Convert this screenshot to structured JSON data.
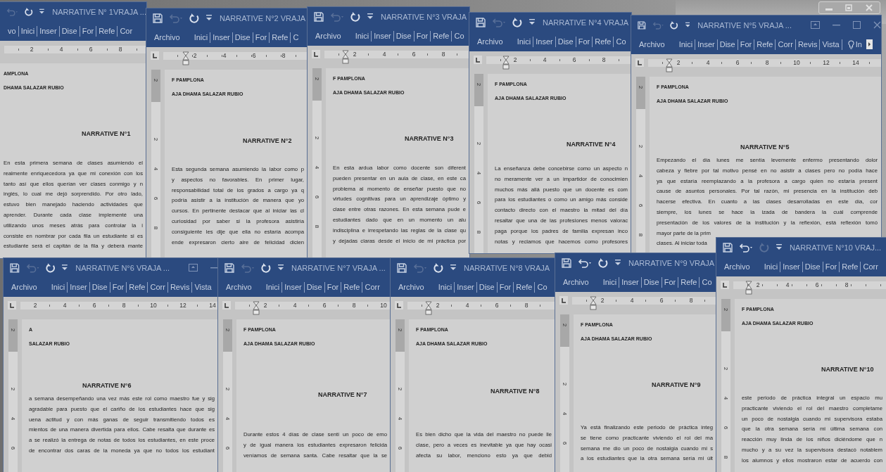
{
  "windows": [
    {
      "title": "NARRATIVE N° 1VRAJA ...",
      "undo_enabled": false,
      "redo_enabled": true,
      "tabs": [
        "vo",
        "Inici",
        "Inser",
        "Dise",
        "For",
        "Refe",
        "Cor"
      ],
      "ruler": [
        "2",
        "4",
        "6",
        "8"
      ],
      "document": {
        "header": [
          "AMPLONA",
          "DHAMA SALAZAR RUBIO"
        ],
        "heading": "NARRATIVE N°1",
        "lines": [
          "En esta primera semana de clases asumiendo el",
          "realmente enriquecedora ya que mi conexión con los",
          "tanto así que ellos querían ver clases conmigo y n",
          "inglés, lo cual me dejó sorprendido. Por otro lado,",
          "estuvo bien manejado haciendo actividades que",
          "aprender. Durante cada clase implementé una",
          "utilizando unos meses atrás para controlar la i",
          "consiste en nombrar por cada fila un estudiante si es",
          "estudiante será el capitán de la fila y deberá mante"
        ]
      }
    },
    {
      "title": "NARRATIVE N°2 VRAJA",
      "undo_enabled": false,
      "redo_enabled": true,
      "tabs": [
        "Archivo",
        "Inici",
        "Inser",
        "Dise",
        "For",
        "Refe",
        "C"
      ],
      "ruler": [
        "2",
        "4",
        "6",
        "8"
      ],
      "vertical_ruler": [
        "2",
        "2",
        "4",
        "6",
        "8"
      ],
      "document": {
        "header": [
          "F PAMPLONA",
          "AJA DHAMA SALAZAR RUBIO"
        ],
        "heading": "NARRATIVE N°2",
        "lines": [
          "Esta segunda semana asumiendo la labor como p",
          "y aspectos no favorables. En primer lugar,",
          "responsabilidad total de los grados a cargo ya q",
          "podría asistir a la institución de manera que yo",
          "cursos. En pertinente destacar que al iniciar las cl",
          "curiosidad por saber si la profesora asistiría",
          "consiguiente les dije que ella no estaría acompa",
          "ende expresaron cierto aire de felicidad dicien"
        ]
      }
    },
    {
      "title": "NARRATIVE N°3 VRAJA",
      "undo_enabled": false,
      "redo_enabled": true,
      "tabs": [
        "Archivo",
        "Inici",
        "Inser",
        "Dise",
        "For",
        "Refe",
        "Co"
      ],
      "ruler": [
        "2",
        "4",
        "6",
        "8"
      ],
      "vertical_ruler": [
        "2",
        "2",
        "4",
        "6",
        "8"
      ],
      "document": {
        "header": [
          "F PAMPLONA",
          "AJA DHAMA SALAZAR RUBIO"
        ],
        "heading": "NARRATIVE N°3",
        "lines": [
          "En esta ardua labor como docente son diferent",
          "pueden presentar en un aula de clase, en este ca",
          "problema al momento de enseñar puesto que no",
          "virtudes cognitivas para un aprendizaje óptimo y",
          "clase entre otras razones. En esta semana pude e",
          "estudiantes dado que en un momento un alu",
          "indisciplina e irrespetando las reglas de la clase qu",
          "y dejadas claras desde el inicio de mi práctica por"
        ]
      }
    },
    {
      "title": "NARRATIVE N°4 VRAJA",
      "undo_enabled": false,
      "redo_enabled": true,
      "tabs": [
        "Archivo",
        "Inici",
        "Inser",
        "Dise",
        "For",
        "Refe",
        "Co"
      ],
      "ruler": [
        "2",
        "4",
        "6",
        "8"
      ],
      "vertical_ruler": [
        "2",
        "2",
        "4",
        "6",
        "8"
      ],
      "document": {
        "header": [
          "F PAMPLONA",
          "AJA DHAMA SALAZAR RUBIO"
        ],
        "heading": "NARRATIVE N°4",
        "lines": [
          "La enseñanza debe concebirse como un aspecto n",
          "no meramente ver a un impartidor de conocimien",
          "muchos más allá puesto que un docente es com",
          "para los estudiantes o como un amigo más conside",
          "contacto directo con el maestro la mitad del día",
          "resaltar que una de las profesiones menos valorac",
          "paga porque los padres de familia expresan inco",
          "notas y reclamos que hacemos como profesores"
        ]
      }
    },
    {
      "title": "NARRATIVE N°5 VRAJA ...",
      "undo_enabled": false,
      "redo_enabled": true,
      "tabs": [
        "Archivo",
        "Inici",
        "Inser",
        "Dise",
        "For",
        "Refe",
        "Corr",
        "Revis",
        "Vista"
      ],
      "tell_me": "In",
      "ruler": [
        "2",
        "4",
        "6",
        "8",
        "10",
        "12",
        "14"
      ],
      "vertical_ruler": [
        "2",
        "2",
        "4",
        "6",
        "8"
      ],
      "document": {
        "header": [
          "F PAMPLONA",
          "AJA DHAMA SALAZAR RUBIO"
        ],
        "heading": "NARRATIVE N°5",
        "lines": [
          "Empezando el día lunes me sentía levemente enfermo presentando dolor",
          "cabeza y fiebre por tal motivo pensé en no asistir a clases pero no podía hace",
          "ya que estaría reemplazando a la profesora a cargo quien no estaría present",
          "cause de asuntos personales. Por tal razón, mi presencia en la institución deb",
          "hacerse efectiva. En cuanto a las clases desarrolladas en este día, cor",
          "siempre, los lunes se hace la izada de bandera la cuál comprende",
          "presentación de los valores de la institución y la reflexión, está reflexión tomó",
          "mayor parte de la prim",
          "clases. Al iniciar toda"
        ]
      }
    },
    {
      "title": "NARRATIVE N°6 VRAJA ...",
      "undo_enabled": false,
      "redo_enabled": true,
      "tabs": [
        "Archivo",
        "Inici",
        "Inser",
        "Dise",
        "For",
        "Refe",
        "Corr",
        "Revis",
        "Vista"
      ],
      "ruler": [
        "2",
        "4",
        "6",
        "8",
        "10",
        "12",
        "14"
      ],
      "vertical_ruler": [
        "2",
        "2",
        "4",
        "6"
      ],
      "document": {
        "header": [
          "A",
          "SALAZAR RUBIO"
        ],
        "heading": "NARRATIVE N°6",
        "lines": [
          "a semana desempeñando una vez más este rol como maestro fue y sig",
          "agradable para puesto que el cariño de los estudiantes hace que sig",
          "uena actitud y con más ganas de seguir transmitiendo todos es",
          "mientos de una manera divertida para ellos. Cabe resalta que durante es",
          "a se realizó la entrega de notas de todos los estudiantes, en este proce",
          "de encontrar dos caras de la moneda ya que no todos los estudiant"
        ]
      }
    },
    {
      "title": "NARRATIVE N°7 VRAJA ...",
      "undo_enabled": false,
      "redo_enabled": true,
      "tabs": [
        "Archivo",
        "Inici",
        "Inser",
        "Dise",
        "For",
        "Refe",
        "Corr"
      ],
      "ruler": [
        "2",
        "4",
        "6",
        "8",
        "10"
      ],
      "vertical_ruler": [
        "2",
        "2",
        "4",
        "6"
      ],
      "document": {
        "header": [
          "F PAMPLONA",
          "AJA DHAMA SALAZAR RUBIO"
        ],
        "heading": "NARRATIVE N°7",
        "lines": [
          "Durante estos 4 días de clase sentí un poco de emo",
          "y de igual manera los estudiantes expresaron felicida",
          "veníamos de semana santa. Cabe resaltar que la se"
        ]
      }
    },
    {
      "title": "NARRATIVE N°8 VRAJA",
      "undo_enabled": false,
      "redo_enabled": true,
      "tabs": [
        "Archivo",
        "Inici",
        "Inser",
        "Dise",
        "For",
        "Refe",
        "Co"
      ],
      "ruler": [
        "2",
        "4",
        "6",
        "8"
      ],
      "vertical_ruler": [
        "2",
        "2",
        "4",
        "6"
      ],
      "document": {
        "header": [
          "F PAMPLONA",
          "AJA DHAMA SALAZAR RUBIO"
        ],
        "heading": "NARRATIVE N°8",
        "lines": [
          "Es bien dicho que la vida del maestro no puede lle",
          "clase, pero a veces es inevitable ya que hay ocasi",
          "afecta su labor, menciono esto ya que debid"
        ]
      }
    },
    {
      "title": "NARRATIVE N°9 VRAJA",
      "undo_enabled": true,
      "redo_enabled": true,
      "tabs": [
        "Archivo",
        "Inici",
        "Inser",
        "Dise",
        "For",
        "Refe",
        "Co"
      ],
      "ruler": [
        "2",
        "4",
        "6",
        "8"
      ],
      "vertical_ruler": [
        "2",
        "2",
        "4",
        "6"
      ],
      "document": {
        "header": [
          "F PAMPLONA",
          "AJA DHAMA SALAZAR RUBIO"
        ],
        "heading": "NARRATIVE N°9",
        "lines": [
          "Ya está finalizando este periodo de práctica integ",
          "se tiene como practicante viviendo el rol del ma",
          "semana me dio un poco de nostalgia cuando mi s",
          "a los estudiantes que la otra semana sería mi últ"
        ]
      }
    },
    {
      "title": "NARRATIVE N°10 VRAJ...",
      "undo_enabled": true,
      "redo_enabled": false,
      "tabs": [
        "Archivo",
        "Inici",
        "Inser",
        "Dise",
        "For",
        "Refe",
        "Corr"
      ],
      "ruler": [
        "2",
        "4",
        "6",
        "8"
      ],
      "vertical_ruler": [
        "2",
        "2",
        "4",
        "6",
        "8"
      ],
      "document": {
        "header": [
          "F PAMPLONA",
          "AJA DHAMA SALAZAR RUBIO"
        ],
        "heading": "NARRATIVE N°10",
        "lines": [
          "este periodo de práctica integral un espacio mu",
          "practicante viviendo el rol del maestro completame",
          "un poco de nostalgia cuando mi supervisora estaba",
          "que la otra semana sería mi última semana con",
          "reacción muy linda de los niños diciéndome que n",
          "mucho y a su vez la supervisora destacó notablem",
          "los alumnos y ellos mostraron estar de acuerdo con"
        ]
      }
    }
  ]
}
